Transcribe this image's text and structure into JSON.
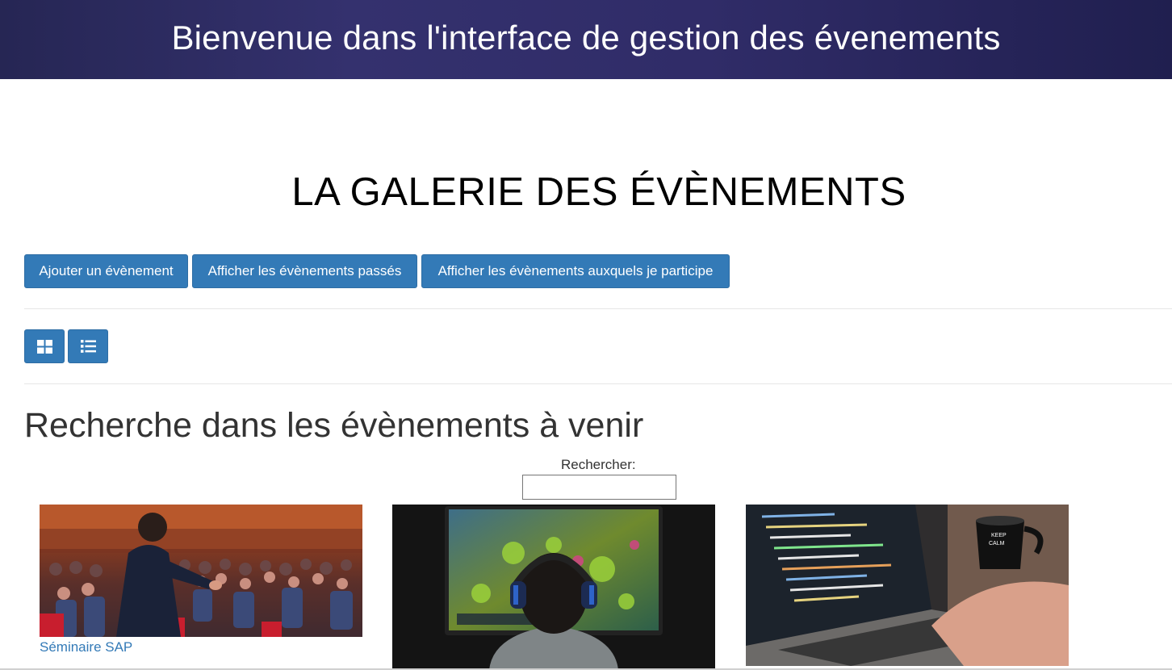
{
  "header": {
    "title": "Bienvenue dans l'interface de gestion des évenements"
  },
  "gallery": {
    "title": "LA GALERIE DES ÉVÈNEMENTS"
  },
  "actions": {
    "add_event": "Ajouter un évènement",
    "show_past": "Afficher les évènements passés",
    "show_participating": "Afficher les évènements auxquels je participe"
  },
  "view_toggle": {
    "grid_icon": "grid-icon",
    "list_icon": "list-icon"
  },
  "search_section": {
    "title": "Recherche dans les évènements à venir",
    "label": "Rechercher:",
    "value": ""
  },
  "events": [
    {
      "title": "Séminaire SAP",
      "image": "conference-photo"
    },
    {
      "title": "",
      "image": "gaming-photo"
    },
    {
      "title": "",
      "image": "coding-laptop-photo"
    }
  ],
  "colors": {
    "header_bg": "#2e2b66",
    "button": "#337ab7",
    "link": "#337ab7"
  }
}
